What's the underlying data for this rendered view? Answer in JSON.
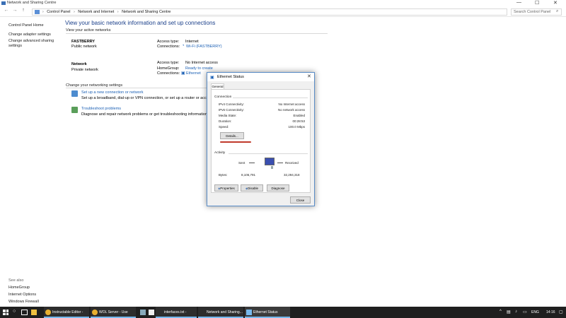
{
  "window": {
    "title": "Network and Sharing Centre",
    "minimize": "—",
    "maximize": "☐",
    "close": "✕"
  },
  "address": {
    "crumbs": [
      "Control Panel",
      "Network and Internet",
      "Network and Sharing Centre"
    ],
    "search_placeholder": "Search Control Panel"
  },
  "left_pane": {
    "home": "Control Panel Home",
    "links": [
      "Change adapter settings",
      "Change advanced sharing",
      "settings"
    ],
    "see_also_heading": "See also",
    "see_also": [
      "HomeGroup",
      "Internet Options",
      "Windows Firewall"
    ]
  },
  "main": {
    "heading": "View your basic network information and set up connections",
    "active_networks_label": "View your active networks",
    "networks": [
      {
        "name": "FASTBERRY",
        "category": "Public network",
        "access_type_label": "Access type:",
        "access_type": "Internet",
        "connections_label": "Connections:",
        "connection": "Wi-Fi (FASTBERRY)"
      },
      {
        "name": "Network",
        "category": "Private network",
        "access_type_label": "Access type:",
        "access_type": "No Internet access",
        "homegroup_label": "HomeGroup:",
        "homegroup": "Ready to create",
        "connections_label": "Connections:",
        "connection": "Ethernet"
      }
    ],
    "change_settings_label": "Change your networking settings",
    "tasks": [
      {
        "title": "Set up a new connection or network",
        "desc": "Set up a broadband, dial-up or VPN connection, or set up a router or access point."
      },
      {
        "title": "Troubleshoot problems",
        "desc": "Diagnose and repair network problems or get troubleshooting information."
      }
    ]
  },
  "dialog": {
    "title": "Ethernet Status",
    "close": "✕",
    "tab": "General",
    "connection_heading": "Connection",
    "rows": [
      {
        "label": "IPv4 Connectivity:",
        "value": "No Internet access"
      },
      {
        "label": "IPv6 Connectivity:",
        "value": "No network access"
      },
      {
        "label": "Media State:",
        "value": "Enabled"
      },
      {
        "label": "Duration:",
        "value": "00:28:53"
      },
      {
        "label": "Speed:",
        "value": "100.0 Mbps"
      }
    ],
    "details_button": "Details...",
    "activity_heading": "Activity",
    "sent_label": "Sent",
    "received_label": "Received",
    "bytes_label": "Bytes:",
    "bytes_sent": "8,106,791",
    "bytes_received": "32,294,318",
    "properties_button": "Properties",
    "disable_button": "Disable",
    "diagnose_button": "Diagnose",
    "close_button": "Close",
    "accent_underline": "#c0392b"
  },
  "taskbar": {
    "items": [
      "Instructable Editor - G...",
      "WOL Server - Use you...",
      "interfaces.txt - Notep...",
      "Network and Sharing...",
      "Ethernet Status"
    ],
    "language": "ENG",
    "time": "14:16"
  }
}
